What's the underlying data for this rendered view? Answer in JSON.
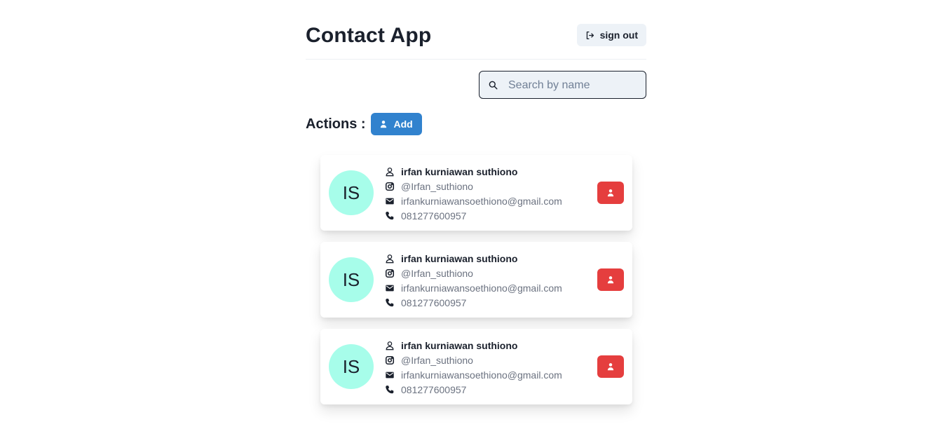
{
  "app": {
    "title": "Contact App",
    "signout_label": "sign out"
  },
  "search": {
    "placeholder": "Search by name",
    "value": ""
  },
  "actions": {
    "label": "Actions :",
    "add_label": "Add"
  },
  "colors": {
    "primary": "#3182ce",
    "danger": "#e53e3e",
    "avatar_bg": "#a7fdea",
    "muted_text": "#6b7280",
    "search_bg": "#edf2f7"
  },
  "contacts": [
    {
      "initials": "IS",
      "name": "irfan kurniawan suthiono",
      "instagram": "@Irfan_suthiono",
      "email": "irfankurniawansoethiono@gmail.com",
      "phone": "081277600957"
    },
    {
      "initials": "IS",
      "name": "irfan kurniawan suthiono",
      "instagram": "@Irfan_suthiono",
      "email": "irfankurniawansoethiono@gmail.com",
      "phone": "081277600957"
    },
    {
      "initials": "IS",
      "name": "irfan kurniawan suthiono",
      "instagram": "@Irfan_suthiono",
      "email": "irfankurniawansoethiono@gmail.com",
      "phone": "081277600957"
    }
  ],
  "icons": {
    "signout": "sign-out-icon",
    "search": "search-icon",
    "add": "add-user-icon",
    "name": "user-icon",
    "instagram": "instagram-icon",
    "email": "mail-icon",
    "phone": "phone-icon",
    "delete": "delete-user-icon"
  }
}
